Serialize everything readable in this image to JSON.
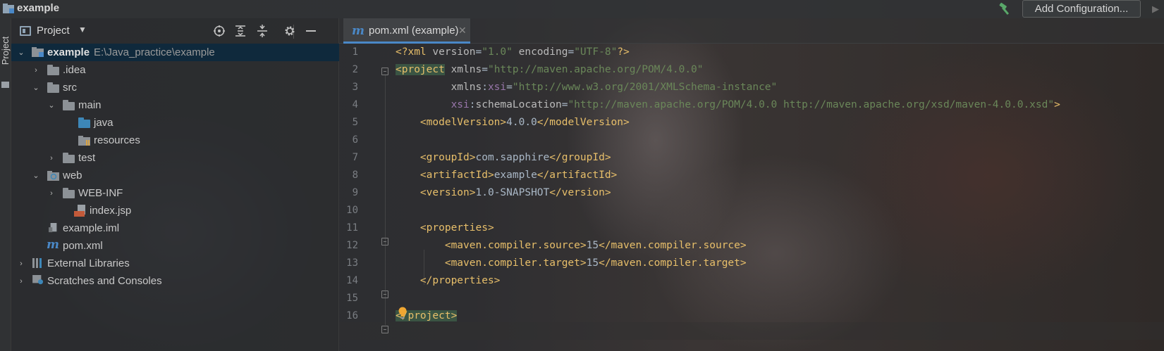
{
  "titlebar": {
    "project_name": "example",
    "run_config_label": "Add Configuration..."
  },
  "side_stripe": {
    "label": "Project"
  },
  "project_panel": {
    "title": "Project",
    "tools": [
      "locate-icon",
      "expand-all-icon",
      "collapse-all-icon",
      "gear-icon",
      "minimize-icon"
    ],
    "tree": [
      {
        "label": "example",
        "path": "E:\\Java_practice\\example",
        "icon": "module-folder-icon",
        "expanded": true
      },
      {
        "label": ".idea",
        "icon": "folder-icon",
        "expanded": false
      },
      {
        "label": "src",
        "icon": "folder-icon",
        "expanded": true
      },
      {
        "label": "main",
        "icon": "folder-icon",
        "expanded": true
      },
      {
        "label": "java",
        "icon": "source-folder-icon"
      },
      {
        "label": "resources",
        "icon": "resources-folder-icon"
      },
      {
        "label": "test",
        "icon": "folder-icon",
        "expanded": false
      },
      {
        "label": "web",
        "icon": "web-folder-icon",
        "expanded": true
      },
      {
        "label": "WEB-INF",
        "icon": "folder-icon",
        "expanded": false
      },
      {
        "label": "index.jsp",
        "icon": "jsp-file-icon"
      },
      {
        "label": "example.iml",
        "icon": "iml-file-icon"
      },
      {
        "label": "pom.xml",
        "icon": "maven-file-icon"
      },
      {
        "label": "External Libraries",
        "icon": "libraries-icon",
        "expanded": false
      },
      {
        "label": "Scratches and Consoles",
        "icon": "scratches-icon",
        "expanded": false
      }
    ]
  },
  "editor": {
    "tab": {
      "label": "pom.xml (example)",
      "icon": "maven-file-icon"
    },
    "line_numbers": [
      "1",
      "2",
      "3",
      "4",
      "5",
      "6",
      "7",
      "8",
      "9",
      "10",
      "11",
      "12",
      "13",
      "14",
      "15",
      "16"
    ],
    "lines": [
      "<?xml version=\"1.0\" encoding=\"UTF-8\"?>",
      "<project xmlns=\"http://maven.apache.org/POM/4.0.0\"",
      "         xmlns:xsi=\"http://www.w3.org/2001/XMLSchema-instance\"",
      "         xsi:schemaLocation=\"http://maven.apache.org/POM/4.0.0 http://maven.apache.org/xsd/maven-4.0.0.xsd\">",
      "    <modelVersion>4.0.0</modelVersion>",
      "",
      "    <groupId>com.sapphire</groupId>",
      "    <artifactId>example</artifactId>",
      "    <version>1.0-SNAPSHOT</version>",
      "",
      "    <properties>",
      "        <maven.compiler.source>15</maven.compiler.source>",
      "        <maven.compiler.target>15</maven.compiler.target>",
      "    </properties>",
      "",
      "</project>"
    ],
    "current_line": "16"
  },
  "colors": {
    "tag": "#e8bf6a",
    "attr_value": "#6a8759",
    "namespace": "#9876aa",
    "selection": "#0d293e",
    "accent": "#4a88c7"
  }
}
